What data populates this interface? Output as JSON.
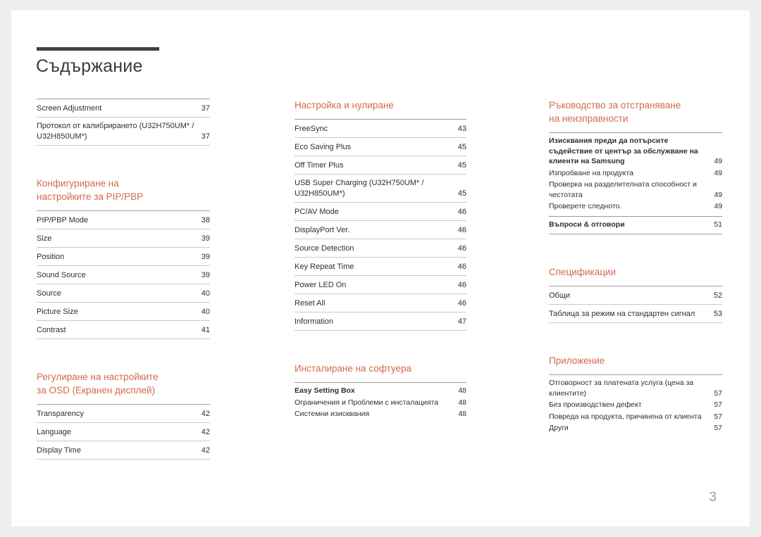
{
  "document": {
    "title": "Съдържание",
    "page_number": "3",
    "accent_color": "#d26a4c",
    "title_rule_color": "#413f4c",
    "page_background": "#ffffff",
    "canvas_background": "#efeeee"
  },
  "columns": [
    {
      "id": "column-1",
      "sections": [
        {
          "id": "screen-adjustment",
          "heading": null,
          "entries": [
            {
              "label": "Screen Adjustment",
              "page": "37"
            },
            {
              "label": "Протокол от калибрирането\n(U32H750UM* / U32H850UM*)",
              "page": "37"
            }
          ]
        },
        {
          "id": "pip-pbp",
          "heading": "Конфигуриране на\nнастройките за PIP/PBP",
          "entries": [
            {
              "label": "PIP/PBP Mode",
              "page": "38"
            },
            {
              "label": "Size",
              "page": "39"
            },
            {
              "label": "Position",
              "page": "39"
            },
            {
              "label": "Sound Source",
              "page": "39"
            },
            {
              "label": "Source",
              "page": "40"
            },
            {
              "label": "Picture Size",
              "page": "40"
            },
            {
              "label": "Contrast",
              "page": "41"
            }
          ]
        },
        {
          "id": "osd-settings",
          "heading": "Регулиране на настройките\nза OSD (Екранен дисплей)",
          "entries": [
            {
              "label": "Transparency",
              "page": "42"
            },
            {
              "label": "Language",
              "page": "42"
            },
            {
              "label": "Display Time",
              "page": "42"
            }
          ]
        }
      ]
    },
    {
      "id": "column-2",
      "sections": [
        {
          "id": "setup-and-reset",
          "heading": "Настройка и нулиране",
          "entries": [
            {
              "label": "FreeSync",
              "page": "43"
            },
            {
              "label": "Eco Saving Plus",
              "page": "45"
            },
            {
              "label": "Off Timer Plus",
              "page": "45"
            },
            {
              "label": "USB Super Charging (U32H750UM* /\nU32H850UM*)",
              "page": "45"
            },
            {
              "label": "PC/AV Mode",
              "page": "46"
            },
            {
              "label": "DisplayPort Ver.",
              "page": "46"
            },
            {
              "label": "Source Detection",
              "page": "46"
            },
            {
              "label": "Key Repeat Time",
              "page": "46"
            },
            {
              "label": "Power LED On",
              "page": "46"
            },
            {
              "label": "Reset All",
              "page": "46"
            },
            {
              "label": "Information",
              "page": "47"
            }
          ]
        }
      ],
      "dense_sections": [
        {
          "id": "software-installation",
          "heading": "Инсталиране на софтуера",
          "entries": [
            {
              "label": "Easy Setting Box",
              "page": "48",
              "strong": true
            },
            {
              "label": "Ограничения и Проблеми с инсталацията",
              "page": "48",
              "strong": false
            },
            {
              "label": "Системни изисквания",
              "page": "48",
              "strong": false
            }
          ]
        }
      ]
    },
    {
      "id": "column-3",
      "dense_sections": [
        {
          "id": "troubleshooting",
          "heading": "Ръководство за отстраняване\nна неизправности",
          "entries": [
            {
              "label": "Изисквания преди да потърсите съдействие от\nцентър за обслужване на клиенти на Samsung",
              "page": "49",
              "strong": true
            },
            {
              "label": "Изпробване на продукта",
              "page": "49",
              "strong": false
            },
            {
              "label": "Проверка на разделителната способност и\nчестотата",
              "page": "49",
              "strong": false
            },
            {
              "label": "Проверете следното.",
              "page": "49",
              "strong": false
            }
          ],
          "footer_entries": [
            {
              "label": "Въпроси & отговори",
              "page": "51",
              "strong": true
            }
          ]
        },
        {
          "id": "specifications",
          "heading": "Спецификации",
          "ruled_entries": [
            {
              "label": "Общи",
              "page": "52"
            },
            {
              "label": "Таблица за режим на стандартен сигнал",
              "page": "53"
            }
          ]
        },
        {
          "id": "appendix",
          "heading": "Приложение",
          "entries": [
            {
              "label": "Отговорност за платената услуга\n(цена за клиентите)",
              "page": "57",
              "strong": false
            },
            {
              "label": "Без производствен дефект",
              "page": "57",
              "strong": false
            },
            {
              "label": "Повреда на продукта, причинена от клиента",
              "page": "57",
              "strong": false
            },
            {
              "label": "Други",
              "page": "57",
              "strong": false
            }
          ]
        }
      ]
    }
  ]
}
